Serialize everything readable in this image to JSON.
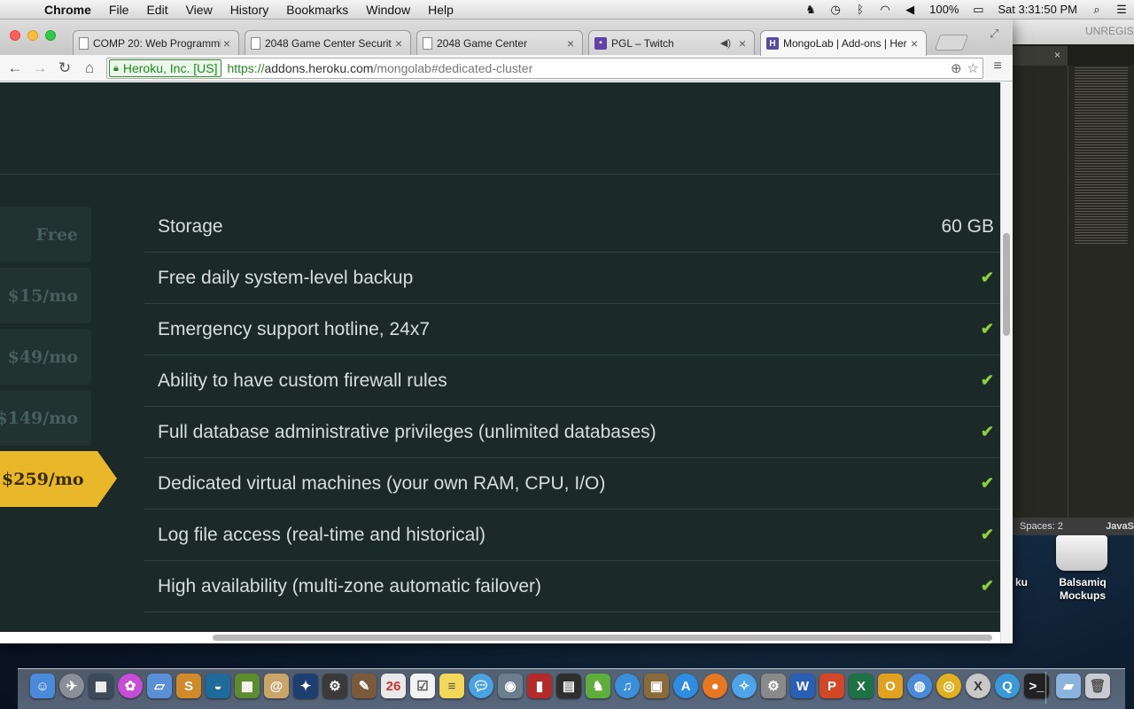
{
  "menubar": {
    "apple": "",
    "items": [
      "Chrome",
      "File",
      "Edit",
      "View",
      "History",
      "Bookmarks",
      "Window",
      "Help"
    ],
    "battery": "100%",
    "clock": "Sat 3:31:50 PM"
  },
  "tabs": [
    {
      "title": "COMP 20: Web Programmi",
      "icon": "document-icon"
    },
    {
      "title": "2048 Game Center Securit",
      "icon": "document-icon"
    },
    {
      "title": "2048 Game Center",
      "icon": "document-icon"
    },
    {
      "title": "PGL – Twitch",
      "icon": "twitch-icon"
    },
    {
      "title": "MongoLab | Add-ons | Her",
      "icon": "heroku-icon"
    }
  ],
  "omnibox": {
    "ev_label": "Heroku, Inc. [US]",
    "scheme": "https://",
    "host": "addons.heroku.com",
    "path": "/mongolab#dedicated-cluster"
  },
  "plans": [
    {
      "label": "Free",
      "selected": false
    },
    {
      "label": "$15/mo",
      "selected": false
    },
    {
      "label": "$49/mo",
      "selected": false
    },
    {
      "label": "$149/mo",
      "selected": false
    },
    {
      "label": "$259/mo",
      "selected": true
    }
  ],
  "features": [
    {
      "label": "Storage",
      "value": "60 GB"
    },
    {
      "label": "Free daily system-level backup",
      "value": "✔"
    },
    {
      "label": "Emergency support hotline, 24x7",
      "value": "✔"
    },
    {
      "label": "Ability to have custom firewall rules",
      "value": "✔"
    },
    {
      "label": "Full database administrative privileges (unlimited databases)",
      "value": "✔"
    },
    {
      "label": "Dedicated virtual machines (your own RAM, CPU, I/O)",
      "value": "✔"
    },
    {
      "label": "Log file access (real-time and historical)",
      "value": "✔"
    },
    {
      "label": "High availability (multi-zone automatic failover)",
      "value": "✔"
    }
  ],
  "editor": {
    "title": "UNREGIST",
    "status_spaces": "Spaces: 2",
    "status_lang": "JavaS"
  },
  "desktop": {
    "partial_label": "ku",
    "drive_label": "Balsamiq Mockups"
  },
  "colors": {
    "page_bg": "#1b2a29",
    "selected_plan": "#e9b72a",
    "check": "#8fce3e"
  }
}
